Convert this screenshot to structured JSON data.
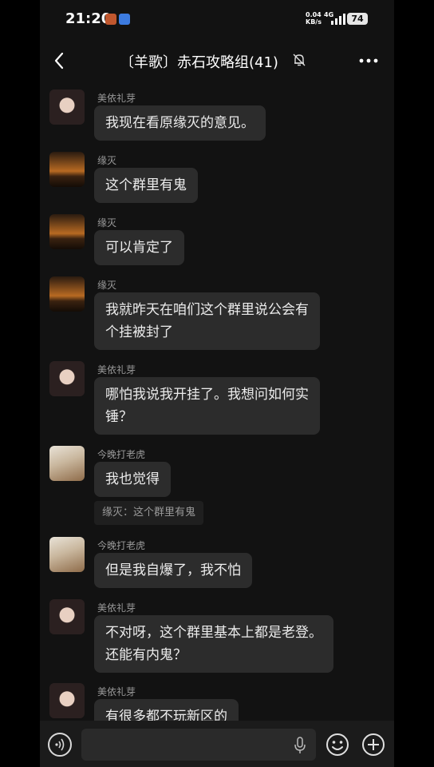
{
  "status_bar": {
    "time": "21:20",
    "net_speed": "0.04",
    "net_unit": "KB/s",
    "network": "4G",
    "battery": "74"
  },
  "header": {
    "title": "〔羊歌〕赤石攻略组(41)",
    "back_icon": "chevron-left-icon",
    "mute_icon": "bell-off-icon",
    "more_icon": "more-horizontal-icon"
  },
  "messages": [
    {
      "sender": "美依礼芽",
      "avatar": "girl-avatar",
      "lines": [
        "我现在看原缘灭的意见。"
      ]
    },
    {
      "sender": "缘灭",
      "avatar": "sunset-avatar",
      "lines": [
        "这个群里有鬼"
      ]
    },
    {
      "sender": "缘灭",
      "avatar": "sunset-avatar",
      "lines": [
        "可以肯定了"
      ]
    },
    {
      "sender": "缘灭",
      "avatar": "sunset-avatar",
      "lines": [
        "我就昨天在咱们这个群里说公会有",
        "个挂被封了"
      ]
    },
    {
      "sender": "美依礼芽",
      "avatar": "girl-avatar",
      "lines": [
        "哪怕我说我开挂了。我想问如何实",
        "锤？"
      ]
    },
    {
      "sender": "今晚打老虎",
      "avatar": "tiger-avatar",
      "lines": [
        "我也觉得"
      ]
    },
    {
      "sender": "今晚打老虎",
      "avatar": "tiger-avatar",
      "lines": [
        "但是我自爆了，我不怕"
      ]
    },
    {
      "sender": "美依礼芽",
      "avatar": "girl-avatar",
      "lines": [
        "不对呀，这个群里基本上都是老登。",
        "还能有内鬼？"
      ]
    },
    {
      "sender": "美依礼芽",
      "avatar": "girl-avatar",
      "lines": [
        "有很多都不玩新区的"
      ]
    }
  ],
  "quote_reply": "缘灭：这个群里有鬼",
  "input_bar": {
    "input_value": "",
    "voice_icon": "voice-icon",
    "mic_icon": "mic-icon",
    "emoji_icon": "emoji-icon",
    "plus_icon": "plus-icon"
  },
  "colors": {
    "background": "#121212",
    "bubble": "#2c2c2c",
    "sender_name": "#9a9a9a"
  }
}
